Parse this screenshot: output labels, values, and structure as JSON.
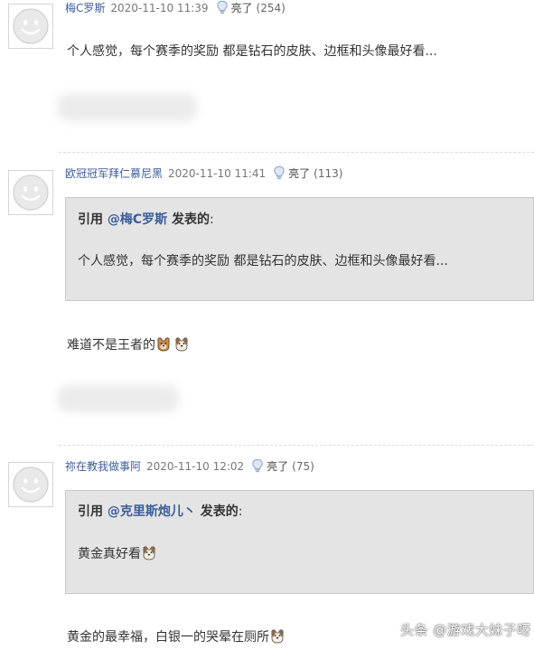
{
  "comments": [
    {
      "username": "梅C罗斯",
      "datetime": "2020-11-10 11:39",
      "like_label": "亮了",
      "like_count": "(254)",
      "text": "个人感觉，每个赛季的奖励 都是钻石的皮肤、边框和头像最好看..."
    },
    {
      "username": "欧冠冠军拜仁慕尼黑",
      "datetime": "2020-11-10 11:41",
      "like_label": "亮了",
      "like_count": "(113)",
      "quote": {
        "prefix": "引用 ",
        "author": "@梅C罗斯",
        "suffix": " 发表的",
        "colon": ":",
        "text": "个人感觉，每个赛季的奖励 都是钻石的皮肤、边框和头像最好看..."
      },
      "text": "难道不是王者的"
    },
    {
      "username": "祢在教我做事阿",
      "datetime": "2020-11-10 12:02",
      "like_label": "亮了",
      "like_count": "(75)",
      "quote": {
        "prefix": "引用 ",
        "author": "@克里斯炮儿丶",
        "suffix": " 发表的",
        "colon": ":",
        "text": "黄金真好看"
      },
      "text": "黄金的最幸福，白银一的哭晕在厕所"
    }
  ],
  "watermark": "头条 @游戏大妹子呀",
  "colors": {
    "username": "#3b5d9a",
    "quote_bg": "#e4e4e4",
    "quote_border": "#c8c8c8"
  },
  "icons": [
    "default-avatar",
    "lightbulb-icon",
    "doge-emoji"
  ]
}
